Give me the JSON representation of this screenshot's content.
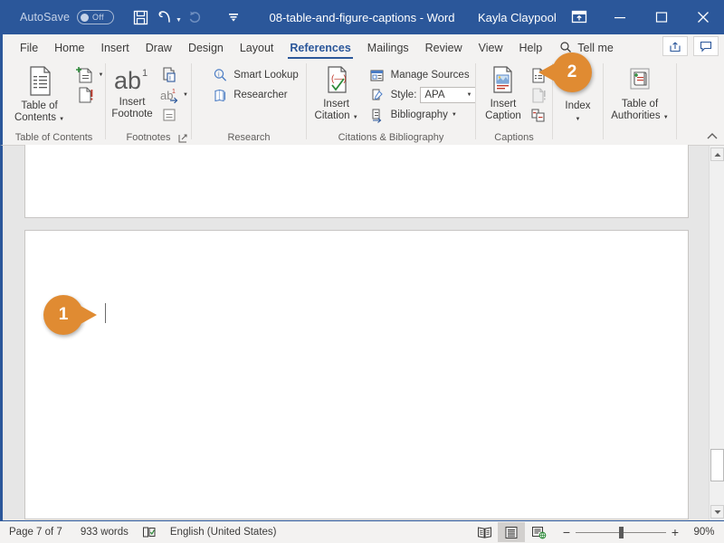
{
  "titlebar": {
    "autosave_label": "AutoSave",
    "autosave_state": "Off",
    "document_title": "08-table-and-figure-captions - Word",
    "user_name": "Kayla Claypool",
    "qat": [
      {
        "name": "save-icon",
        "label": "Save"
      },
      {
        "name": "undo-icon",
        "label": "Undo"
      },
      {
        "name": "redo-icon",
        "label": "Redo"
      },
      {
        "name": "customize-quick-access-toolbar-icon",
        "label": "Customize Quick Access Toolbar"
      }
    ],
    "ribbon_display_options": "Ribbon Display Options",
    "minimize": "Minimize",
    "restore": "Restore Down",
    "close": "Close"
  },
  "tabs": [
    {
      "label": "File",
      "active": false
    },
    {
      "label": "Home",
      "active": false
    },
    {
      "label": "Insert",
      "active": false
    },
    {
      "label": "Draw",
      "active": false
    },
    {
      "label": "Design",
      "active": false
    },
    {
      "label": "Layout",
      "active": false
    },
    {
      "label": "References",
      "active": true
    },
    {
      "label": "Mailings",
      "active": false
    },
    {
      "label": "Review",
      "active": false
    },
    {
      "label": "View",
      "active": false
    },
    {
      "label": "Help",
      "active": false
    }
  ],
  "tellme": {
    "label": "Tell me",
    "icon": "search-icon"
  },
  "tab_right_buttons": [
    {
      "name": "share-icon",
      "label": "Share"
    },
    {
      "name": "comments-icon",
      "label": "Comments"
    }
  ],
  "ribbon": {
    "groups": [
      {
        "name": "table-of-contents",
        "label": "Table of Contents",
        "big_button": {
          "line1": "Table of",
          "line2": "Contents",
          "has_caret": true
        },
        "small_buttons": [
          {
            "label": "",
            "name": "add-text-button",
            "has_caret": true
          },
          {
            "label": "",
            "name": "update-table-button",
            "has_caret": false
          }
        ]
      },
      {
        "name": "footnotes",
        "label": "Footnotes",
        "big_button": {
          "line1": "Insert",
          "line2": "Footnote",
          "has_caret": false
        },
        "small_buttons": [
          {
            "label": "",
            "name": "insert-endnote-button",
            "has_caret": false
          },
          {
            "label": "",
            "name": "next-footnote-button",
            "has_caret": true
          },
          {
            "label": "",
            "name": "show-notes-button",
            "has_caret": false
          }
        ],
        "has_dialog_launcher": true
      },
      {
        "name": "research",
        "label": "Research",
        "small_buttons": [
          {
            "label": "Smart Lookup",
            "name": "smart-lookup-button"
          },
          {
            "label": "Researcher",
            "name": "researcher-button"
          }
        ]
      },
      {
        "name": "citations-and-bibliography",
        "label": "Citations & Bibliography",
        "big_button": {
          "line1": "Insert",
          "line2": "Citation",
          "has_caret": true
        },
        "small_buttons": [
          {
            "label": "Manage Sources",
            "name": "manage-sources-button"
          },
          {
            "label": "Style:",
            "name": "citation-style-label"
          },
          {
            "label": "Bibliography",
            "name": "bibliography-button",
            "has_caret": true
          }
        ],
        "style_value": "APA"
      },
      {
        "name": "captions",
        "label": "Captions",
        "big_button": {
          "line1": "Insert",
          "line2": "Caption",
          "has_caret": false
        },
        "small_buttons": [
          {
            "label": "",
            "name": "insert-table-of-figures-button"
          },
          {
            "label": "",
            "name": "update-table-of-figures-button"
          },
          {
            "label": "",
            "name": "cross-reference-button"
          }
        ]
      },
      {
        "name": "index",
        "label": "",
        "big_button": {
          "line1": "Index",
          "line2": "",
          "has_caret": true
        },
        "small_buttons": [
          {
            "label": "",
            "name": "mark-entry-button"
          },
          {
            "label": "",
            "name": "insert-index-button"
          },
          {
            "label": "",
            "name": "update-index-button"
          }
        ]
      },
      {
        "name": "table-of-authorities",
        "label": "",
        "big_button": {
          "line1": "Table of",
          "line2": "Authorities",
          "has_caret": true
        }
      }
    ],
    "collapse_label": "Collapse the Ribbon"
  },
  "document": {
    "pages_visible": 2,
    "cursor_visible": true
  },
  "callouts": [
    {
      "number": "1",
      "target": "document-insertion-point"
    },
    {
      "number": "2",
      "target": "insert-table-of-figures-button"
    }
  ],
  "statusbar": {
    "page_info": "Page 7 of 7",
    "word_count": "933 words",
    "proofing_icon": "proofing-errors-icon",
    "language": "English (United States)",
    "view_buttons": [
      {
        "name": "read-mode-button",
        "active": false
      },
      {
        "name": "print-layout-button",
        "active": true
      },
      {
        "name": "web-layout-button",
        "active": false
      }
    ],
    "zoom_out": "−",
    "zoom_in": "+",
    "zoom_level": "90%"
  },
  "colors": {
    "titlebar": "#2b579a",
    "ribbon_bg": "#f3f2f1",
    "accent": "#2b579a",
    "callout": "#e08b32",
    "workspace": "#e6e6e6",
    "page": "#ffffff"
  }
}
